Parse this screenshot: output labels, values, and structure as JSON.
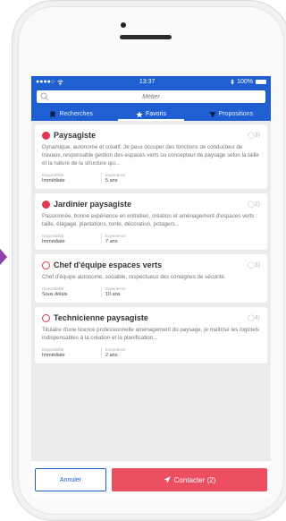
{
  "statusbar": {
    "carrier": "●●●●○",
    "time": "13:37",
    "battery": "100%"
  },
  "search": {
    "placeholder": "Métier"
  },
  "tabs": [
    {
      "label": "Recherches",
      "icon": "bookmark-icon"
    },
    {
      "label": "Favoris",
      "icon": "star-icon"
    },
    {
      "label": "Propositions",
      "icon": "send-icon"
    }
  ],
  "cards": [
    {
      "title": "Paysagiste",
      "count": "3",
      "checked": true,
      "description": "Dynamique, autonome et créatif. Je peux occuper des fonctions de conducteur de travaux, responsable gestion des espaces verts ou concepteur de paysage selon la taille et la nature de la structure qui...",
      "availability_label": "Disponibilité",
      "availability": "Immédiate",
      "experience_label": "Experience",
      "experience": "5 ans"
    },
    {
      "title": "Jardinier paysagiste",
      "count": "2",
      "checked": true,
      "description": "Passionnée, bonne expérience en entretien, création et aménagement d'espaces verts : taille, élagage, plantations, tonte, décoration, potagers...",
      "availability_label": "Disponibilité",
      "availability": "Immédiate",
      "experience_label": "Experience",
      "experience": "7 ans"
    },
    {
      "title": "Chef d'équipe espaces verts",
      "count": "3",
      "checked": false,
      "description": "Chef d'équipe autonome, sociable, respectueux des consignes de sécurité.",
      "availability_label": "Disponibilité",
      "availability": "Sous délais",
      "experience_label": "Experience",
      "experience": "10 ans"
    },
    {
      "title": "Technicienne paysagiste",
      "count": "4",
      "checked": false,
      "description": "Titulaire d'une licence professionnelle aménagement du paysage, je maîtrise les logiciels indispensables à la création et la planification...",
      "availability_label": "Disponibilité",
      "availability": "Immédiate",
      "experience_label": "Experience",
      "experience": "2 ans"
    }
  ],
  "actions": {
    "cancel": "Annuler",
    "contact": "Contacter (2)"
  },
  "colors": {
    "primary": "#1f5fd1",
    "accent": "#ec4e62",
    "check": "#e0384f"
  }
}
